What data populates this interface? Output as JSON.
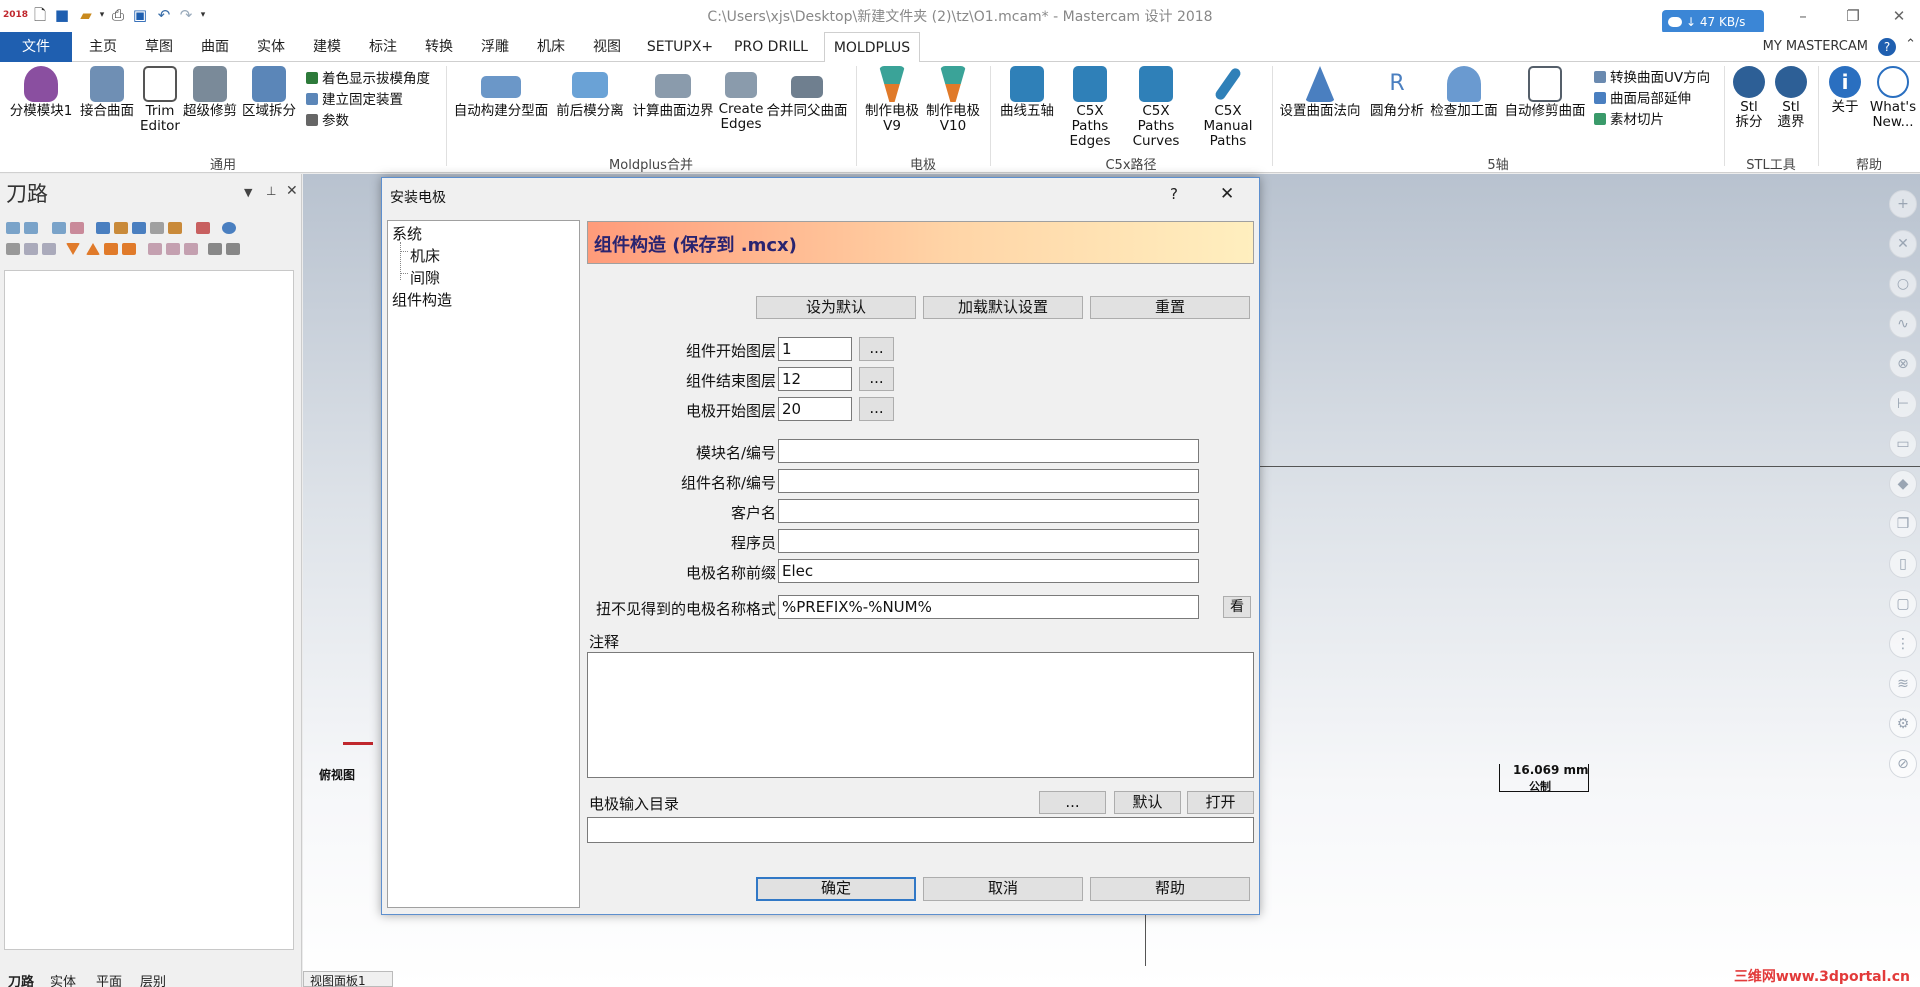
{
  "window": {
    "title": "C:\\Users\\xjs\\Desktop\\新建文件夹 (2)\\tz\\O1.mcam* - Mastercam 设计 2018",
    "net_speed": "↓ 47 KB/s",
    "logo": "2018",
    "controls": {
      "minimize": "–",
      "restore": "❐",
      "close": "✕"
    }
  },
  "tabs": [
    "文件",
    "主页",
    "草图",
    "曲面",
    "实体",
    "建模",
    "标注",
    "转换",
    "浮雕",
    "机床",
    "视图",
    "SETUPX+",
    "PRO DRILL",
    "MOLDPLUS"
  ],
  "account": "MY MASTERCAM",
  "ribbon": {
    "buttons": [
      {
        "label": "分模模块1",
        "color": "#8a4fa0"
      },
      {
        "label": "接合曲面",
        "color": "#6f8fb4"
      },
      {
        "label": "Trim\nEditor",
        "color": "#555555"
      },
      {
        "label": "超级修剪",
        "color": "#7a8a99"
      },
      {
        "label": "区域拆分",
        "color": "#5b86b8"
      },
      {
        "label": "自动构建分型面",
        "color": "#6b97c8"
      },
      {
        "label": "前后模分离",
        "color": "#6aa2d6"
      },
      {
        "label": "计算曲面边界",
        "color": "#8a9bac"
      },
      {
        "label": "Create\nEdges",
        "color": "#8a9bac"
      },
      {
        "label": "合并同父曲面",
        "color": "#6f7f8f"
      },
      {
        "label": "制作电极\nV9",
        "color": "#3aa398"
      },
      {
        "label": "制作电极\nV10",
        "color": "#3aa398"
      },
      {
        "label": "曲线五轴",
        "color": "#2f80b8"
      },
      {
        "label": "C5X Paths\nEdges",
        "color": "#2f80b8"
      },
      {
        "label": "C5X Paths\nCurves",
        "color": "#2f80b8"
      },
      {
        "label": "C5X Manual\nPaths",
        "color": "#2f80b8"
      },
      {
        "label": "设置曲面法向",
        "color": "#4a7fc0"
      },
      {
        "label": "圆角分析",
        "color": "#4a7fc0"
      },
      {
        "label": "检查加工面",
        "color": "#6a9ad0"
      },
      {
        "label": "自动修剪曲面",
        "color": "#555f6a"
      },
      {
        "label": "Stl\n拆分",
        "color": "#2d5f96"
      },
      {
        "label": "Stl\n遗界",
        "color": "#2d5f96"
      },
      {
        "label": "关于",
        "color": "#2a6fc0"
      },
      {
        "label": "What's\nNew...",
        "color": "#2a6fc0"
      }
    ],
    "small_items": [
      {
        "label": "着色显示拔模角度",
        "color": "#2d7a3a"
      },
      {
        "label": "建立固定装置",
        "color": "#5b86b8"
      },
      {
        "label": "参数",
        "color": "#666666"
      },
      {
        "label": "转换曲面UV方向",
        "color": "#6a8ab0"
      },
      {
        "label": "曲面局部延伸",
        "color": "#4a7fc0"
      },
      {
        "label": "素材切片",
        "color": "#3a9a6a"
      }
    ],
    "groups": [
      "通用",
      "Moldplus合并",
      "电极",
      "C5x路径",
      "5轴",
      "STL工具",
      "帮助"
    ]
  },
  "left_panel": {
    "title": "刀路",
    "bottom_tabs": [
      "刀路",
      "实体",
      "平面",
      "层别"
    ]
  },
  "viewport": {
    "view_label": "俯视图",
    "scale_value": "16.069 mm",
    "scale_unit": "公制",
    "view_tab": "视图面板1"
  },
  "watermark": "三维网www.3dportal.cn",
  "dialog": {
    "title": "安装电极",
    "help_glyph": "?",
    "close_glyph": "✕",
    "tree": [
      {
        "label": "系统",
        "level": 0
      },
      {
        "label": "机床",
        "level": 1
      },
      {
        "label": "间隙",
        "level": 1
      },
      {
        "label": "组件构造",
        "level": 0
      }
    ],
    "banner": "组件构造 (保存到 .mcx)",
    "top_buttons": [
      "设为默认",
      "加载默认设置",
      "重置"
    ],
    "layer_fields": [
      {
        "label": "组件开始图层",
        "value": "1"
      },
      {
        "label": "组件结束图层",
        "value": "12"
      },
      {
        "label": "电极开始图层",
        "value": "20"
      }
    ],
    "browse": "...",
    "text_fields": [
      {
        "label": "模块名/编号",
        "value": ""
      },
      {
        "label": "组件名称/编号",
        "value": ""
      },
      {
        "label": "客户名",
        "value": ""
      },
      {
        "label": "程序员",
        "value": ""
      },
      {
        "label": "电极名称前缀",
        "value": "Elec"
      }
    ],
    "hidden_format": {
      "label": "扭不见得到的电极名称格式",
      "value": "%PREFIX%-%NUM%",
      "view_button": "看到"
    },
    "notes_label": "注释",
    "notes_value": "",
    "dir_label": "电极输入目录",
    "dir_buttons": [
      "...",
      "默认",
      "打开"
    ],
    "dir_value": "",
    "bottom_buttons": [
      "确定",
      "取消",
      "帮助"
    ]
  }
}
